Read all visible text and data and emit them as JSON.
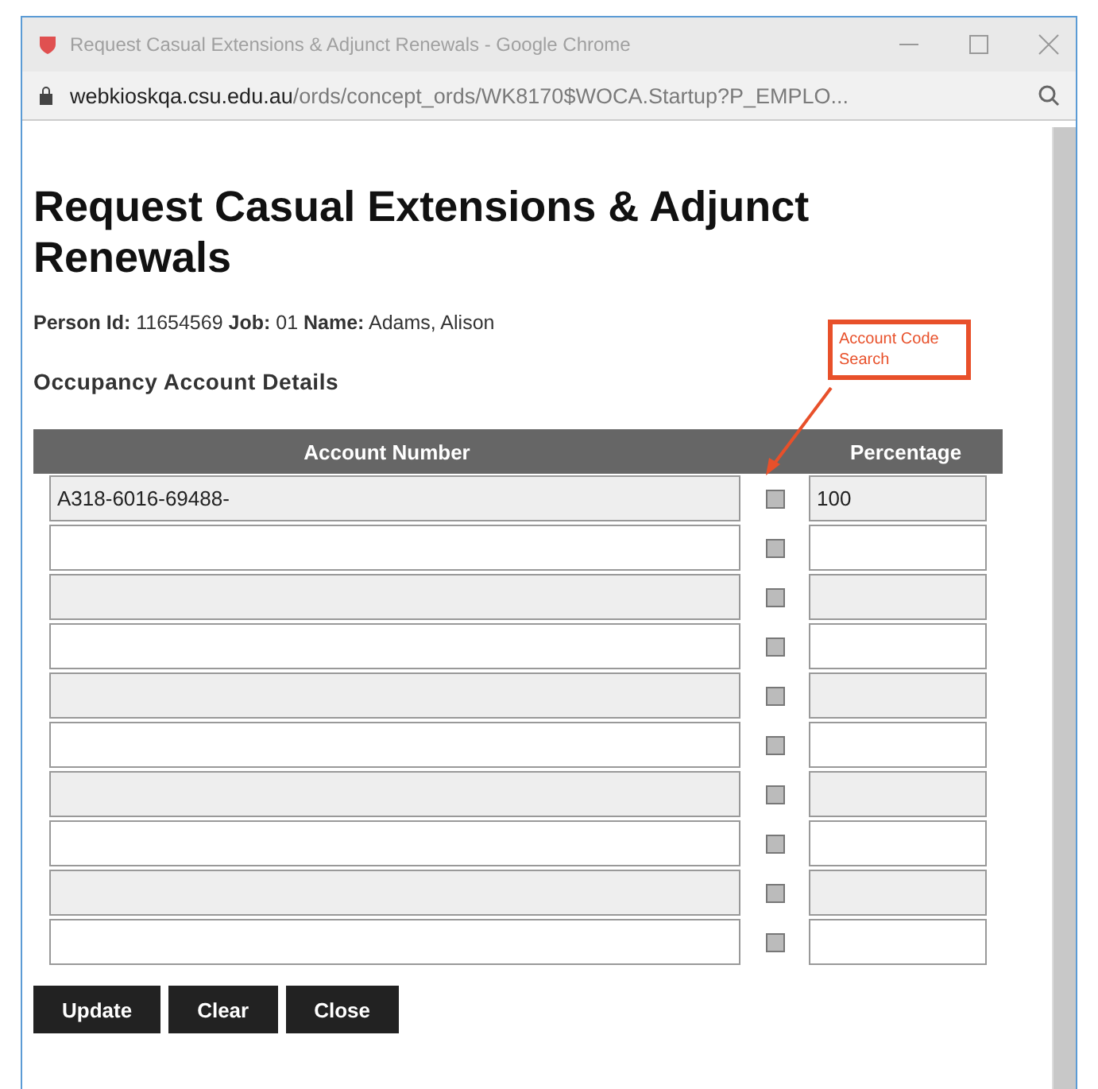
{
  "window": {
    "title": "Request Casual Extensions & Adjunct Renewals - Google Chrome",
    "url_host": "webkioskqa.csu.edu.au",
    "url_path": "/ords/concept_ords/WK8170$WOCA.Startup?P_EMPLO..."
  },
  "page": {
    "title": "Request Casual Extensions & Adjunct Renewals",
    "person_line": "**Person Id:** 11654569 **Job:** 01 **Name:** Adams, Alison",
    "section": "Occupancy Account Details",
    "annotation": "Account Code Search"
  },
  "table": {
    "columns": [
      "Account Number",
      "Percentage"
    ],
    "rows": [
      {
        "account": "A318-6016-69488-",
        "percentage": "100"
      },
      {},
      {},
      {},
      {},
      {},
      {},
      {},
      {},
      {}
    ]
  },
  "buttons": [
    "Update",
    "Clear",
    "Close"
  ]
}
